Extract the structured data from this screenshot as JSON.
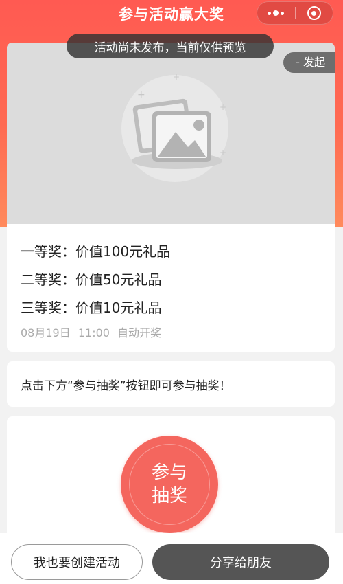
{
  "header": {
    "title": "参与活动赢大奖",
    "menu_icon": "more-dots-icon",
    "close_icon": "target-close-icon"
  },
  "toast": {
    "text": "活动尚未发布，当前仅供预览"
  },
  "cover": {
    "icon": "image-placeholder-icon",
    "launcher_tag": "- 发起"
  },
  "prizes": {
    "items": [
      {
        "label": "一等奖：价值100元礼品"
      },
      {
        "label": "二等奖：价值50元礼品"
      },
      {
        "label": "三等奖：价值10元礼品"
      }
    ],
    "draw_date": "08月19日",
    "draw_time": "11:00",
    "draw_mode": "自动开奖"
  },
  "hint": {
    "text": "点击下方“参与抽奖”按钮即可参与抽奖！"
  },
  "join": {
    "label": "参与抽奖"
  },
  "bottom": {
    "create_label": "我也要创建活动",
    "share_label": "分享给朋友"
  },
  "colors": {
    "brand_red": "#ff5a52",
    "join_button": "#f4665e",
    "share_button": "#555555"
  }
}
